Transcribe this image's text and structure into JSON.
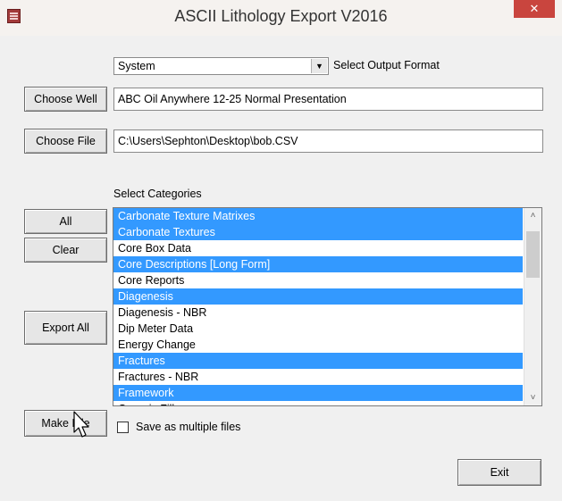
{
  "window": {
    "title": "ASCII Lithology Export V2016",
    "close_glyph": "✕",
    "icon": "app-icon"
  },
  "format": {
    "value": "System",
    "arrow_glyph": "▼",
    "label": "Select Output Format"
  },
  "well": {
    "button_label": "Choose Well",
    "value": "ABC Oil Anywhere 12-25 Normal Presentation"
  },
  "file": {
    "button_label": "Choose File",
    "value": "C:\\Users\\Sephton\\Desktop\\bob.CSV"
  },
  "categories": {
    "label": "Select Categories",
    "items": [
      {
        "label": "Carbonate Texture Matrixes",
        "selected": true
      },
      {
        "label": "Carbonate Textures",
        "selected": true
      },
      {
        "label": "Core Box Data",
        "selected": false
      },
      {
        "label": "Core Descriptions [Long Form]",
        "selected": true
      },
      {
        "label": "Core Reports",
        "selected": false
      },
      {
        "label": "Diagenesis",
        "selected": true
      },
      {
        "label": "Diagenesis - NBR",
        "selected": false
      },
      {
        "label": "Dip Meter Data",
        "selected": false
      },
      {
        "label": "Energy Change",
        "selected": false
      },
      {
        "label": "Fractures",
        "selected": true
      },
      {
        "label": "Fractures - NBR",
        "selected": false
      },
      {
        "label": "Framework",
        "selected": true
      },
      {
        "label": "Generic Fills",
        "selected": false
      }
    ],
    "scroll_up_glyph": "˄",
    "scroll_down_glyph": "˅"
  },
  "buttons": {
    "all": "All",
    "clear": "Clear",
    "export_all": "Export All",
    "make_file": "Make File",
    "exit": "Exit"
  },
  "options": {
    "multiple_files_label": "Save as multiple files",
    "multiple_files_checked": false
  }
}
